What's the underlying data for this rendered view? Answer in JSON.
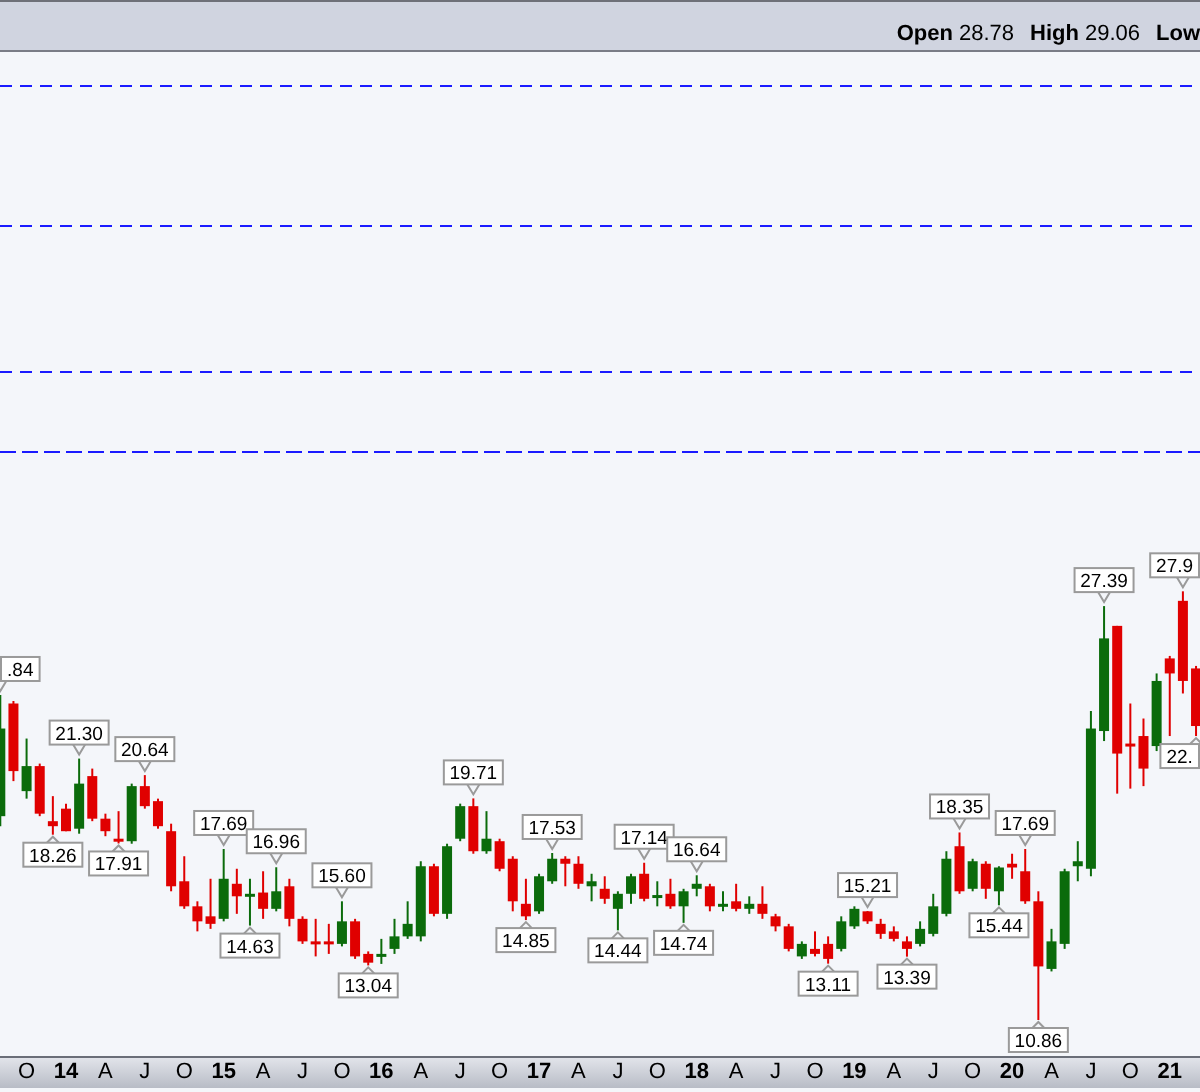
{
  "header": {
    "stats": [
      {
        "label": "Open",
        "value": "28.78"
      },
      {
        "label": "High",
        "value": "29.06"
      },
      {
        "label": "Low"
      }
    ]
  },
  "price_labels": [
    {
      "value": ".84",
      "kind": "above"
    },
    {
      "value": "18.26",
      "kind": "below"
    },
    {
      "value": "21.30",
      "kind": "above"
    },
    {
      "value": "17.91",
      "kind": "below"
    },
    {
      "value": "20.64",
      "kind": "above"
    },
    {
      "value": "17.69",
      "kind": "above"
    },
    {
      "value": "14.63",
      "kind": "below"
    },
    {
      "value": "16.96",
      "kind": "above"
    },
    {
      "value": "15.60",
      "kind": "above"
    },
    {
      "value": "13.04",
      "kind": "below"
    },
    {
      "value": "19.71",
      "kind": "above"
    },
    {
      "value": "14.85",
      "kind": "below"
    },
    {
      "value": "17.53",
      "kind": "above"
    },
    {
      "value": "14.44",
      "kind": "below"
    },
    {
      "value": "17.14",
      "kind": "above"
    },
    {
      "value": "14.74",
      "kind": "below"
    },
    {
      "value": "16.64",
      "kind": "above"
    },
    {
      "value": "13.11",
      "kind": "below"
    },
    {
      "value": "15.21",
      "kind": "above"
    },
    {
      "value": "13.39",
      "kind": "below"
    },
    {
      "value": "18.35",
      "kind": "above"
    },
    {
      "value": "15.44",
      "kind": "below"
    },
    {
      "value": "17.69",
      "kind": "above"
    },
    {
      "value": "10.86",
      "kind": "below"
    },
    {
      "value": "27.39",
      "kind": "above"
    },
    {
      "value": "27.9",
      "kind": "above"
    },
    {
      "value": "22.",
      "kind": "below"
    }
  ],
  "x_axis": [
    {
      "text": "O",
      "kind": "quarter"
    },
    {
      "text": "14",
      "kind": "year"
    },
    {
      "text": "A",
      "kind": "quarter"
    },
    {
      "text": "J",
      "kind": "quarter"
    },
    {
      "text": "O",
      "kind": "quarter"
    },
    {
      "text": "15",
      "kind": "year"
    },
    {
      "text": "A",
      "kind": "quarter"
    },
    {
      "text": "J",
      "kind": "quarter"
    },
    {
      "text": "O",
      "kind": "quarter"
    },
    {
      "text": "16",
      "kind": "year"
    },
    {
      "text": "A",
      "kind": "quarter"
    },
    {
      "text": "J",
      "kind": "quarter"
    },
    {
      "text": "O",
      "kind": "quarter"
    },
    {
      "text": "17",
      "kind": "year"
    },
    {
      "text": "A",
      "kind": "quarter"
    },
    {
      "text": "J",
      "kind": "quarter"
    },
    {
      "text": "O",
      "kind": "quarter"
    },
    {
      "text": "18",
      "kind": "year"
    },
    {
      "text": "A",
      "kind": "quarter"
    },
    {
      "text": "J",
      "kind": "quarter"
    },
    {
      "text": "O",
      "kind": "quarter"
    },
    {
      "text": "19",
      "kind": "year"
    },
    {
      "text": "A",
      "kind": "quarter"
    },
    {
      "text": "J",
      "kind": "quarter"
    },
    {
      "text": "O",
      "kind": "quarter"
    },
    {
      "text": "20",
      "kind": "year"
    },
    {
      "text": "A",
      "kind": "quarter"
    },
    {
      "text": "J",
      "kind": "quarter"
    },
    {
      "text": "O",
      "kind": "quarter"
    },
    {
      "text": "21",
      "kind": "year"
    }
  ]
}
